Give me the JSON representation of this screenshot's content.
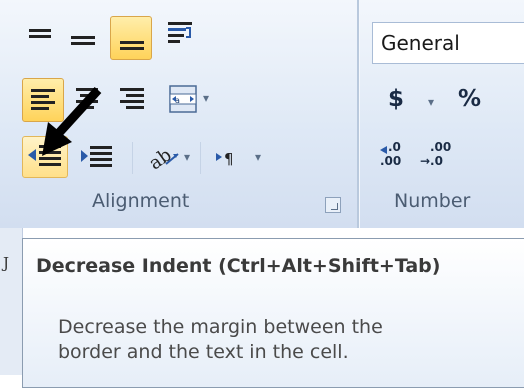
{
  "ribbon": {
    "alignment_group": {
      "label": "Alignment",
      "buttons": [
        "top-align",
        "middle-align",
        "bottom-align",
        "wrap-text",
        "align-left",
        "center",
        "align-right",
        "merge-and-center",
        "decrease-indent",
        "increase-indent",
        "orientation",
        "text-direction"
      ],
      "active": [
        "bottom-align",
        "align-left"
      ],
      "hot": "decrease-indent"
    },
    "number_group": {
      "label": "Number",
      "format_value": "General",
      "currency_symbol": "$",
      "percent_symbol": "%",
      "increase_decimal_top": ".0",
      "increase_decimal_bottom": ".00",
      "decrease_decimal_top": ".00",
      "decrease_decimal_bottom": "→.0"
    }
  },
  "tooltip": {
    "title": "Decrease Indent (Ctrl+Alt+Shift+Tab)",
    "line1": "Decrease the margin between the",
    "line2": "border and the text in the cell."
  },
  "colors": {
    "active_fill": "#ffd35a",
    "ribbon": "#dfe9f6",
    "accent_blue": "#2a5aa8"
  }
}
